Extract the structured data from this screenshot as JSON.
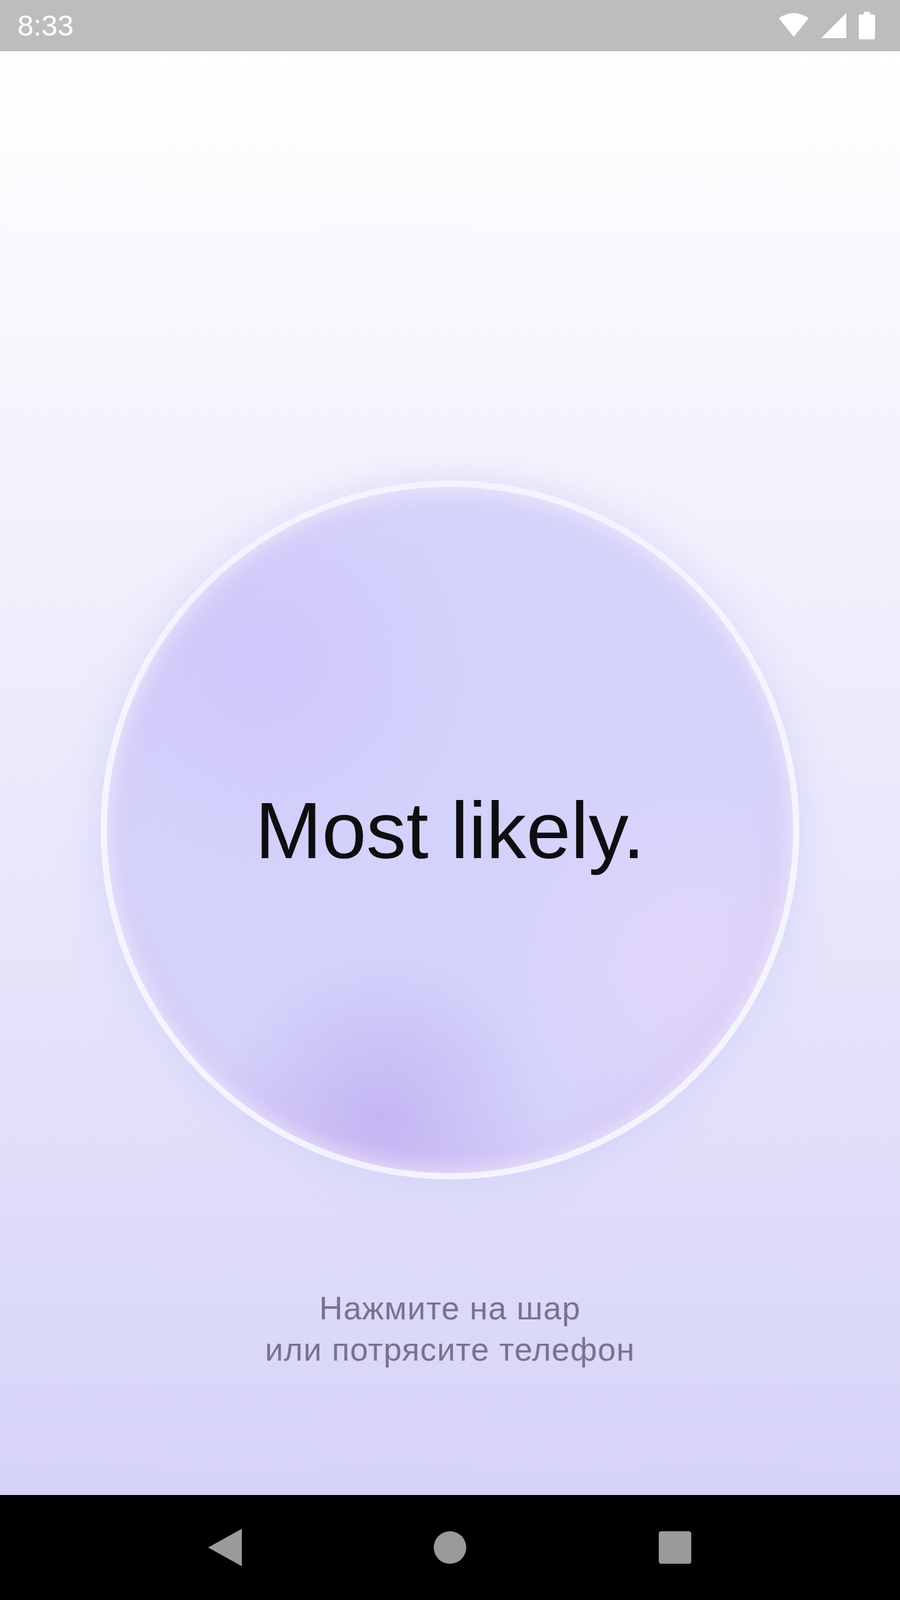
{
  "status_bar": {
    "time": "8:33"
  },
  "ball": {
    "answer": "Most likely."
  },
  "hint": {
    "lines": [
      "Нажмите на шар",
      "или потрясите телефон"
    ]
  }
}
